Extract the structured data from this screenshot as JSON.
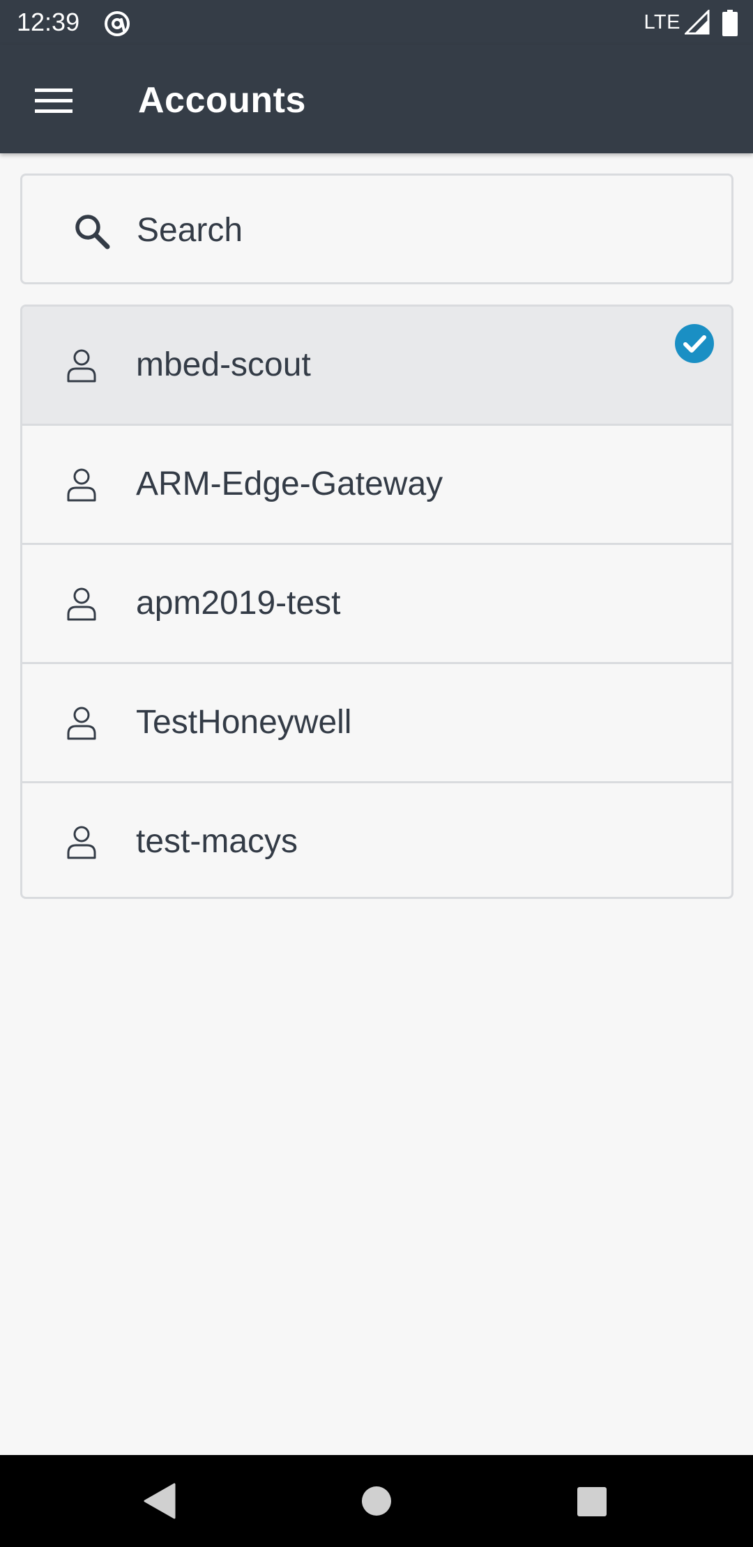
{
  "status_bar": {
    "time": "12:39",
    "network": "LTE",
    "app_icon": "at-sign-icon",
    "signal_icon": "cell-signal-icon",
    "battery_icon": "battery-icon"
  },
  "app_bar": {
    "menu_icon": "hamburger-menu-icon",
    "title": "Accounts"
  },
  "search": {
    "placeholder": "Search",
    "value": ""
  },
  "accounts": [
    {
      "name": "mbed-scout",
      "selected": true
    },
    {
      "name": "ARM-Edge-Gateway",
      "selected": false
    },
    {
      "name": "apm2019-test",
      "selected": false
    },
    {
      "name": "TestHoneywell",
      "selected": false
    },
    {
      "name": "test-macys",
      "selected": false
    }
  ],
  "nav_bar": {
    "back_icon": "back-triangle-icon",
    "home_icon": "home-circle-icon",
    "recents_icon": "recents-square-icon"
  },
  "colors": {
    "app_bar_bg": "#353d47",
    "background": "#f7f7f7",
    "selected_row_bg": "#e8e9eb",
    "border": "#d9dbde",
    "text": "#333b46",
    "check_accent": "#1a8fc4"
  }
}
